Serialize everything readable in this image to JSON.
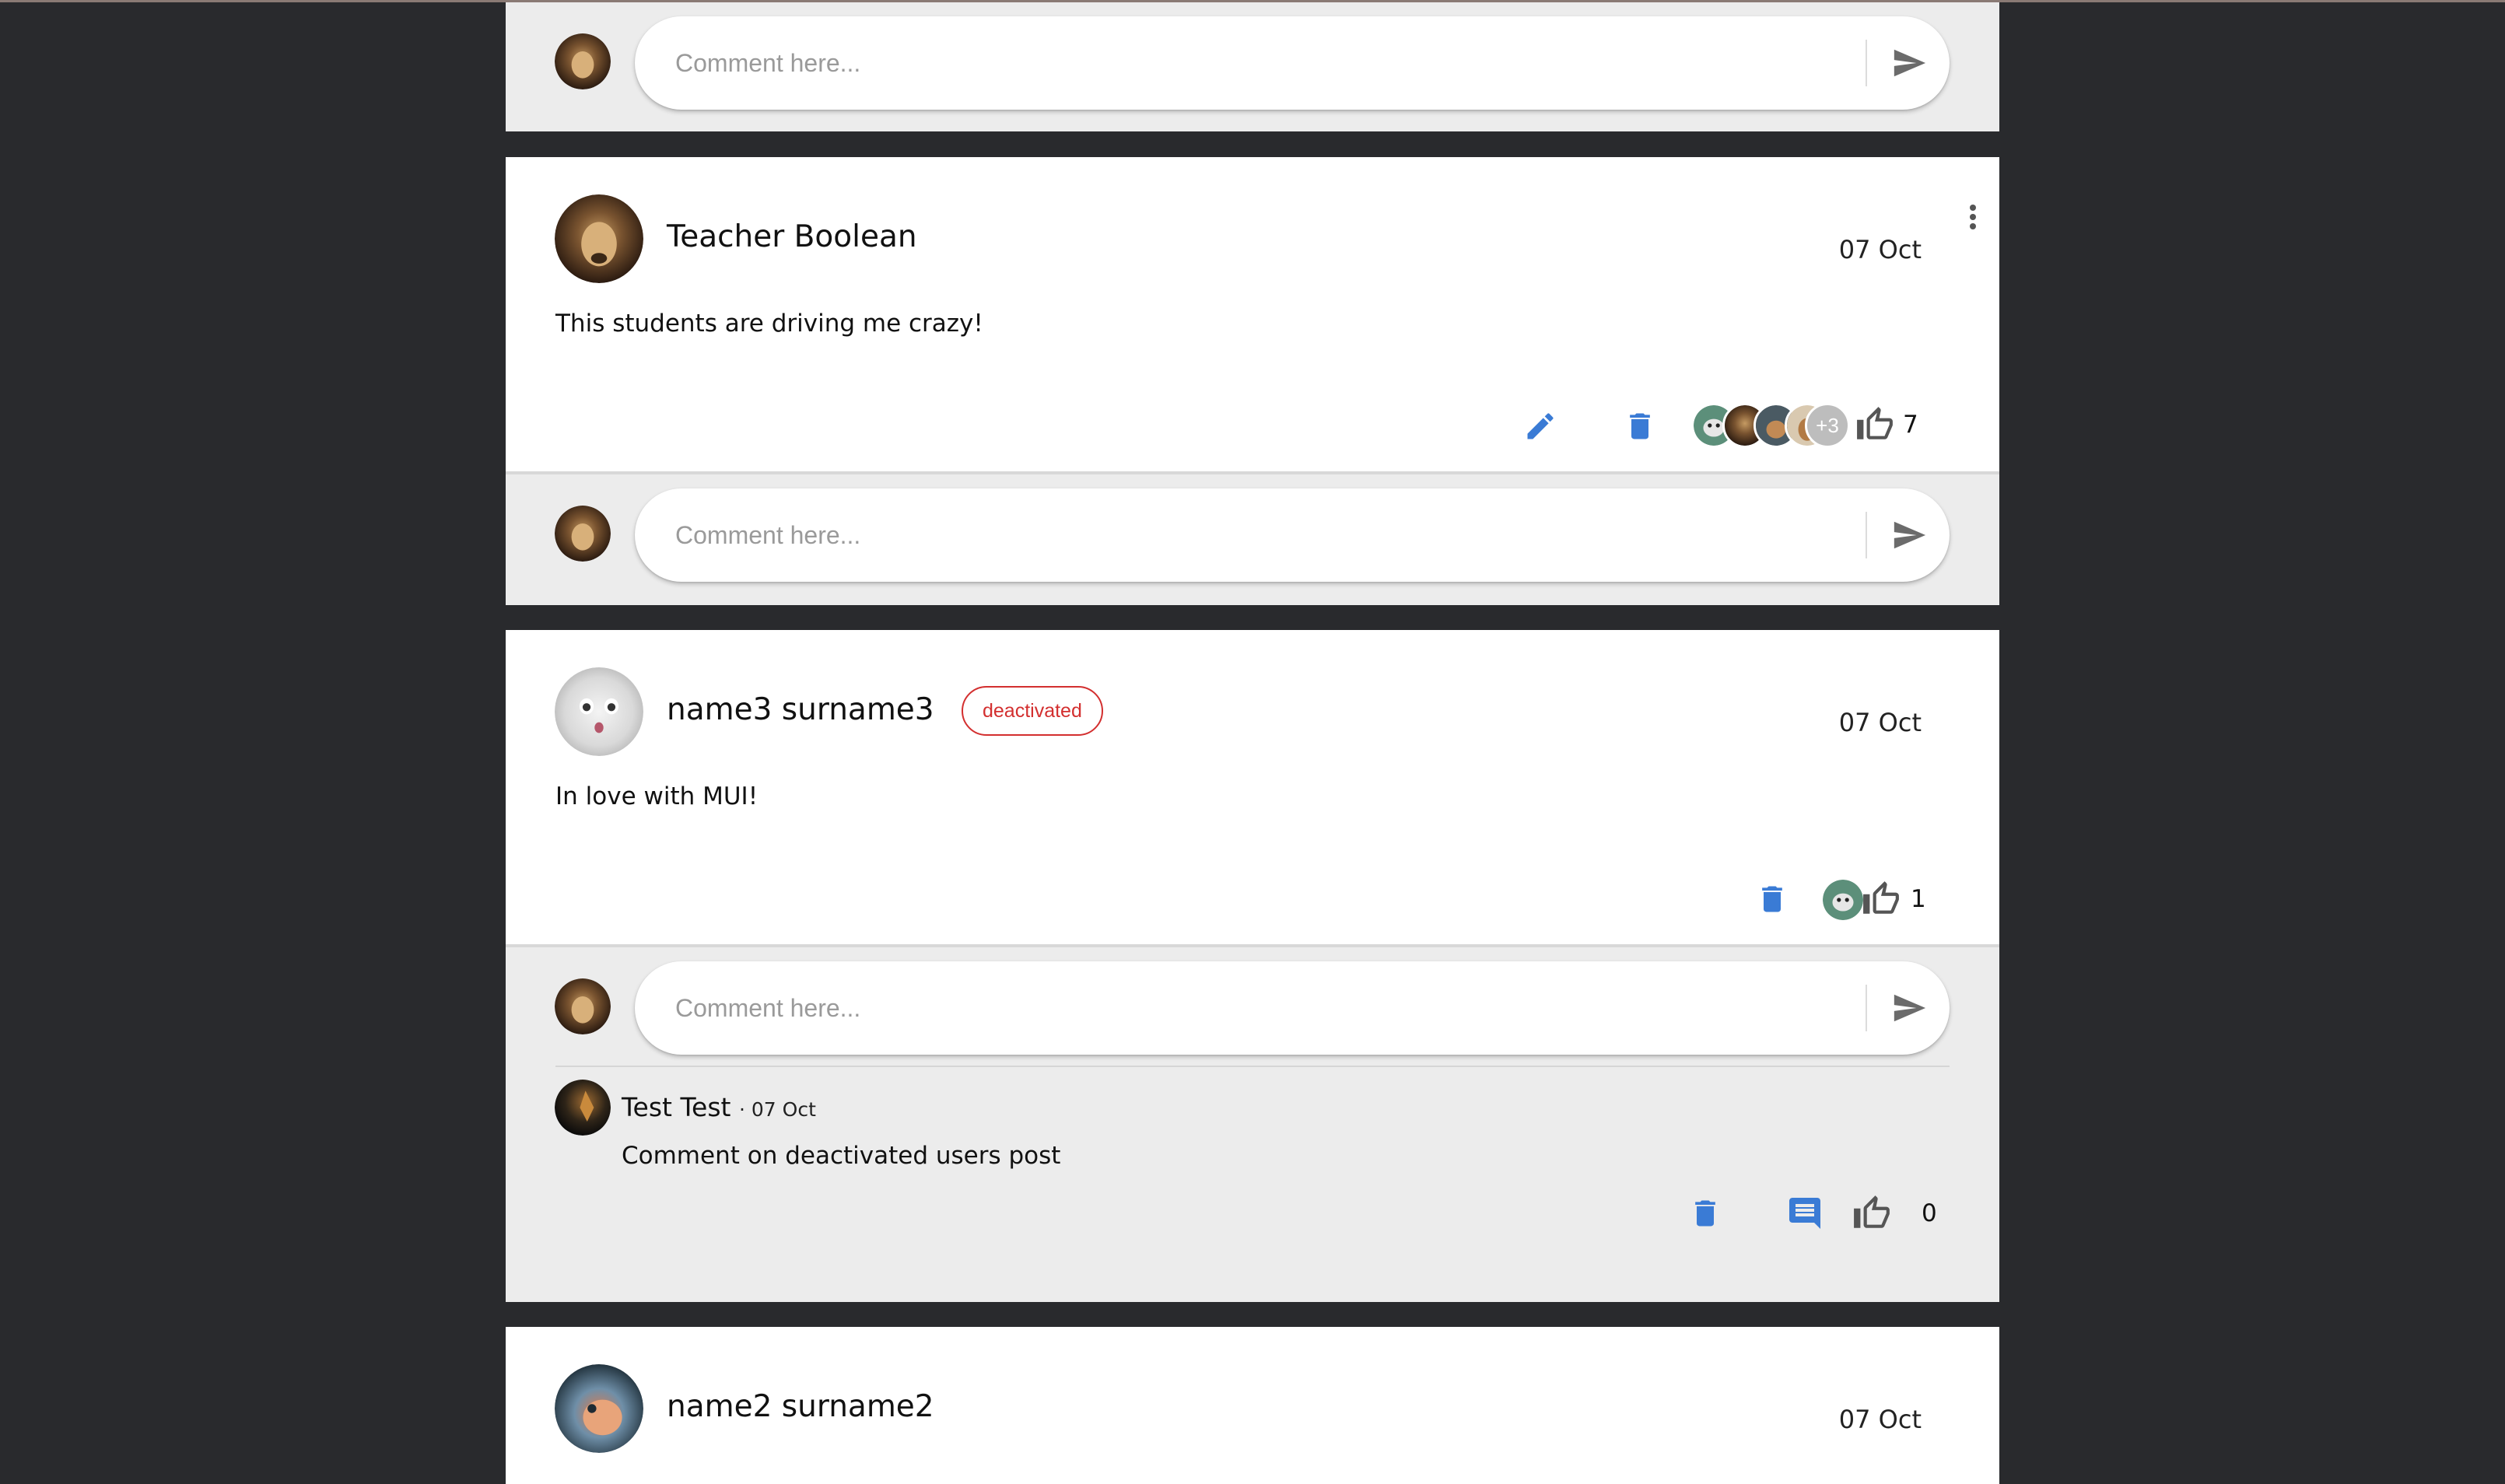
{
  "composer": {
    "placeholder": "Comment here..."
  },
  "posts": [
    {
      "author": "Teacher Boolean",
      "date": "07 Oct",
      "text": "This students are driving me crazy!",
      "likers_more": "+3",
      "like_count": "7"
    },
    {
      "author": "name3 surname3",
      "badge": "deactivated",
      "date": "07 Oct",
      "text": "In love with MUI!",
      "like_count": "1",
      "comments": [
        {
          "author": "Test Test",
          "date": "· 07 Oct",
          "text": "Comment on deactivated users post",
          "like_count": "0"
        }
      ]
    },
    {
      "author": "name2 surname2",
      "date": "07 Oct"
    }
  ],
  "colors": {
    "accent": "#3a7bd5",
    "danger": "#d32f2f",
    "icon_grey": "#555555",
    "page_bg": "#292a2d"
  },
  "icons": {
    "edit": "pencil-icon",
    "delete": "trash-icon",
    "like": "thumb-up-icon",
    "send": "send-icon",
    "reply": "comment-icon",
    "menu": "more-vert-icon"
  }
}
